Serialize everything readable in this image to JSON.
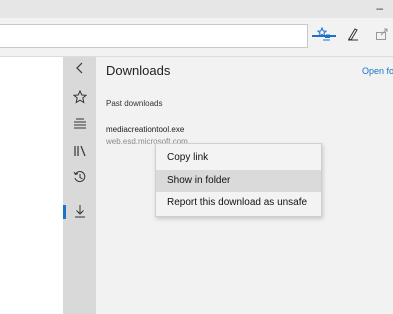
{
  "window": {
    "minimize_glyph": "–"
  },
  "toolbar": {
    "address_value": "",
    "icons": {
      "hub": "hub-favorites-icon",
      "pen": "web-note-pen-icon",
      "share": "share-icon"
    },
    "accent_color": "#1a73c8"
  },
  "hub_rail": {
    "items": [
      {
        "name": "back-chevron-icon",
        "glyph": "‹"
      },
      {
        "name": "favorites-star-icon",
        "glyph": "☆"
      },
      {
        "name": "reading-list-icon",
        "glyph": "☰"
      },
      {
        "name": "books-icon",
        "glyph": "ǁ\\"
      },
      {
        "name": "history-icon",
        "glyph": "↺"
      },
      {
        "name": "downloads-icon",
        "glyph": "⤓"
      }
    ],
    "active": "downloads-icon"
  },
  "downloads": {
    "title": "Downloads",
    "open_folder_label": "Open fo",
    "section_label": "Past downloads",
    "items": [
      {
        "file_name": "mediacreationtool.exe",
        "source": "web.esd.microsoft.com"
      }
    ]
  },
  "context_menu": {
    "items": [
      {
        "label": "Copy link"
      },
      {
        "label": "Show in folder",
        "highlighted": true
      },
      {
        "label": "Report this download as unsafe"
      }
    ]
  }
}
